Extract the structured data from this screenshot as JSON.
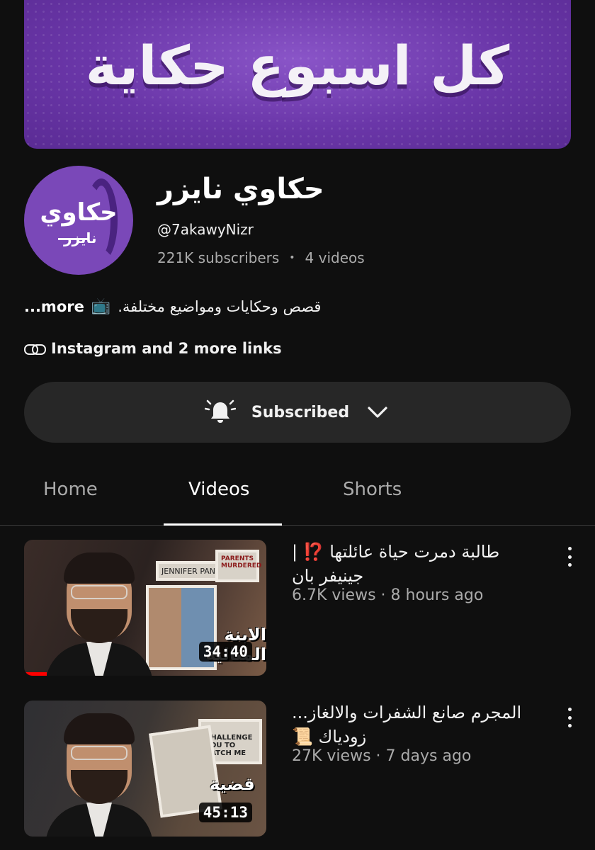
{
  "banner": {
    "text": "كل اسبوع حكاية"
  },
  "channel": {
    "avatar_line1": "حكاوي",
    "avatar_line2": "نايزر",
    "name": "حكاوي نايزر",
    "handle": "@7akawyNizr",
    "subscribers": "221K subscribers",
    "separator": "•",
    "videos": "4 videos"
  },
  "description": {
    "text": "قصص وحكايات ومواضيع مختلفة.",
    "tv_emoji": "📺",
    "more": "...more"
  },
  "links": {
    "label": "Instagram and 2 more links",
    "icon": "link-icon"
  },
  "subscribe": {
    "label": "Subscribed",
    "bell_icon": "bell-ringing-icon",
    "chevron_icon": "chevron-down-icon"
  },
  "tabs": [
    {
      "label": "Home",
      "active": false
    },
    {
      "label": "Videos",
      "active": true
    },
    {
      "label": "Shorts",
      "active": false
    }
  ],
  "videos": [
    {
      "title": "طالبة دمرت حياة عائلتها ⁉️ | جينيفر بان",
      "views": "6.7K views",
      "age": "8 hours ago",
      "duration": "34:40",
      "thumb_caption": "الابنة المثالية",
      "thumb_labels": [
        "JENNIFER PAN",
        "PARENTS MURDERED"
      ]
    },
    {
      "title": "المجرم صانع الشفرات والالغاز... زودياك 📜",
      "views": "27K views",
      "age": "7 days ago",
      "duration": "45:13",
      "thumb_caption": "قضية",
      "thumb_labels": [
        "I CHALLENGE YOU TO CATCH ME"
      ]
    }
  ],
  "meta_separator": "·",
  "colors": {
    "background": "#0f0f0f",
    "banner": "#6a36a8",
    "button": "#272727",
    "progress": "#ff0000"
  }
}
